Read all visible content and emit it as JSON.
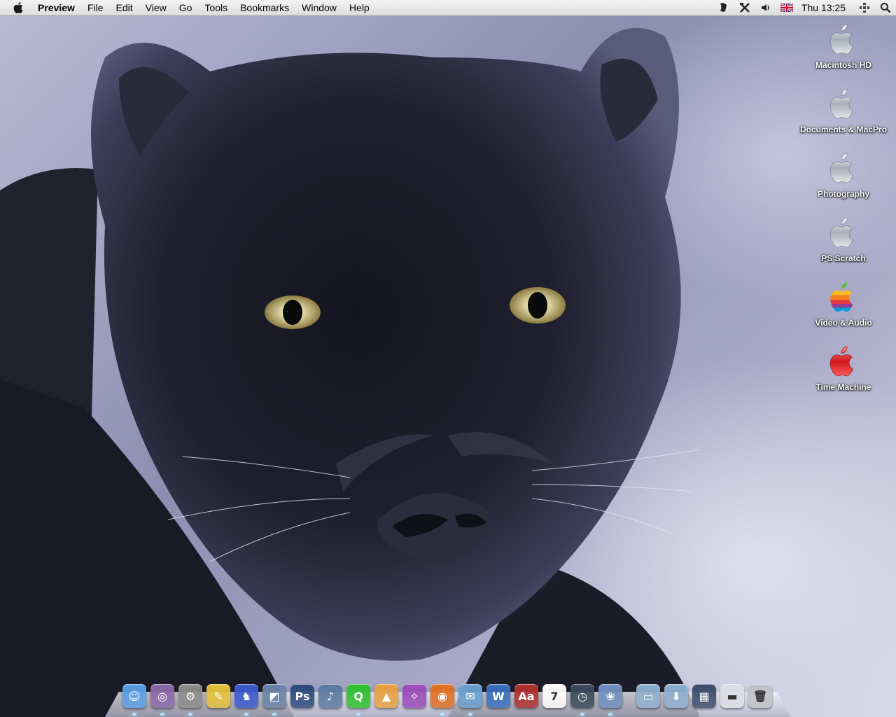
{
  "menubar": {
    "app_name": "Preview",
    "menus": [
      "File",
      "Edit",
      "View",
      "Go",
      "Tools",
      "Bookmarks",
      "Window",
      "Help"
    ],
    "clock": "Thu 13:25",
    "status_icons": [
      "script-icon",
      "tools-icon",
      "volume-icon",
      "uk-flag-icon",
      "spaces-icon",
      "spotlight-icon"
    ]
  },
  "desktop": {
    "icons": [
      {
        "label": "Macintosh HD",
        "style": "silver"
      },
      {
        "label": "Documents & MacPro",
        "style": "silver"
      },
      {
        "label": "Photography",
        "style": "silver"
      },
      {
        "label": "PS Scratch",
        "style": "silver"
      },
      {
        "label": "Video & Audio",
        "style": "rainbow"
      },
      {
        "label": "Time Machine",
        "style": "red"
      }
    ]
  },
  "dock": {
    "apps": [
      {
        "name": "finder-icon",
        "color": "#5aa0e6",
        "glyph": "☺",
        "running": true
      },
      {
        "name": "adium-icon",
        "color": "#8a6aa8",
        "glyph": "◎",
        "running": true
      },
      {
        "name": "system-preferences-icon",
        "color": "#8c8c8c",
        "glyph": "⚙",
        "running": true
      },
      {
        "name": "stickies-ruler-icon",
        "color": "#e6c23a",
        "glyph": "✎",
        "running": false
      },
      {
        "name": "automator-icon",
        "color": "#3a5ad0",
        "glyph": "♞",
        "running": true
      },
      {
        "name": "preview-icon",
        "color": "#6a84a8",
        "glyph": "◩",
        "running": true
      },
      {
        "name": "photoshop-icon",
        "color": "#2b4a7a",
        "glyph": "Ps",
        "running": false
      },
      {
        "name": "itunes-icon",
        "color": "#5a7aa0",
        "glyph": "♪",
        "running": false
      },
      {
        "name": "quicktime-icon",
        "color": "#2ec02e",
        "glyph": "Q",
        "running": true
      },
      {
        "name": "transmit-icon",
        "color": "#e8a040",
        "glyph": "▲",
        "running": false
      },
      {
        "name": "aperture-icon",
        "color": "#9a4ab8",
        "glyph": "✧",
        "running": false
      },
      {
        "name": "firefox-icon",
        "color": "#e07020",
        "glyph": "◉",
        "running": true
      },
      {
        "name": "mail-icon",
        "color": "#6aa0d0",
        "glyph": "✉",
        "running": true
      },
      {
        "name": "word-icon",
        "color": "#3a70c0",
        "glyph": "W",
        "running": false
      },
      {
        "name": "dictionary-icon",
        "color": "#b03030",
        "glyph": "Aa",
        "running": false
      },
      {
        "name": "ical-icon",
        "color": "#ffffff",
        "glyph": "7",
        "running": false
      },
      {
        "name": "time-machine-icon",
        "color": "#3a4a5a",
        "glyph": "◷",
        "running": true
      },
      {
        "name": "iphoto-icon",
        "color": "#7090c0",
        "glyph": "❀",
        "running": true
      }
    ],
    "others": [
      {
        "name": "applications-folder-icon",
        "color": "#8fb0d0",
        "glyph": "▭"
      },
      {
        "name": "downloads-folder-icon",
        "color": "#8fb0d0",
        "glyph": "⬇"
      },
      {
        "name": "minimized-window-icon",
        "color": "#3a4a6a",
        "glyph": "▦"
      },
      {
        "name": "minimized-window-2-icon",
        "color": "#dcdce6",
        "glyph": "▬"
      },
      {
        "name": "trash-icon",
        "color": "#c0c0c8",
        "glyph": "🗑"
      }
    ]
  }
}
